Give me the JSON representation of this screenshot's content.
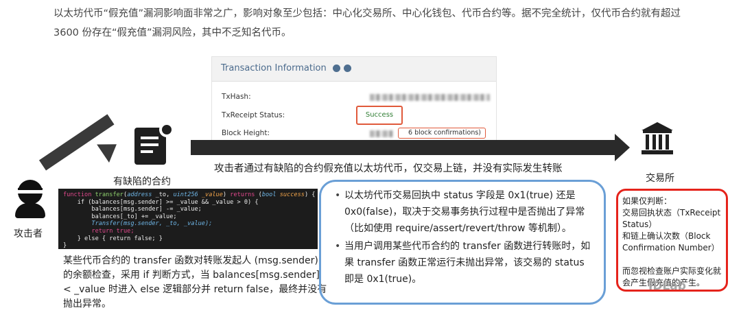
{
  "intro": "以太坊代币“假充值”漏洞影响面非常之广，影响对象至少包括：中心化交易所、中心化钱包、代币合约等。据不完全统计，仅代币合约就有超过 3600 份存在“假充值”漏洞风险，其中不乏知名代币。",
  "tx_panel": {
    "title": "Transaction Information",
    "txhash_label": "TxHash:",
    "receipt_label": "TxReceipt Status:",
    "status_value": "Success",
    "height_label": "Block Height:",
    "confirmations": "6 block confirmations)"
  },
  "flow": {
    "caption": "攻击者通过有缺陷的合约假充值以太坊代币，仅交易上链，并没有实际发生转账",
    "contract_label": "有缺陷的合约",
    "attacker_label": "攻击者",
    "exchange_label": "交易所"
  },
  "code": {
    "line1": {
      "kw": "function",
      "fn": "transfer",
      "p1": "(",
      "t1": "address",
      "a1": " _to, ",
      "t2": "uint256",
      "a2": " _value",
      "p2": ") ",
      "kw2": "returns",
      "p3": " (",
      "t3": "bool",
      "r": " success",
      "p4": ") {"
    },
    "line2": "if (balances[msg.sender] >= _value && _value > 0) {",
    "line3": "balances[msg.sender] -= _value;",
    "line4": "balances[_to] += _value;",
    "line5": "Transfer(msg.sender, _to, _value);",
    "line6": "return true;",
    "line7": "} else { return false; }",
    "line8": "}"
  },
  "description": "某些代币合约的 transfer 函数对转账发起人 (msg.sender)的余额检查，采用 if 判断方式，当 balances[msg.sender] < _value 时进入 else 逻辑部分并 return false，最终并没有抛出异常。",
  "notes": [
    "以太坊代币交易回执中 status 字段是 0x1(true) 还是 0x0(false)，取决于交易事务执行过程中是否抛出了异常（比如使用 require/assert/revert/throw 等机制）。",
    "当用户调用某些代币合约的 transfer 函数进行转账时，如果 transfer 函数正常运行未抛出异常，该交易的 status 即是 0x1(true)。"
  ],
  "exchange_note": {
    "line1": "如果仅判断：",
    "line2": "交易回执状态（TxReceipt Status）",
    "line3": "和链上确认次数（Block Confirmation Number）",
    "line4": "而忽视检查账户实际变化就会产生假充值的产生。"
  },
  "watermark": "IDLab",
  "colors": {
    "highlight_red": "#e5231b",
    "box_blue": "#6a9fd6",
    "success_green": "#2e7d32"
  }
}
